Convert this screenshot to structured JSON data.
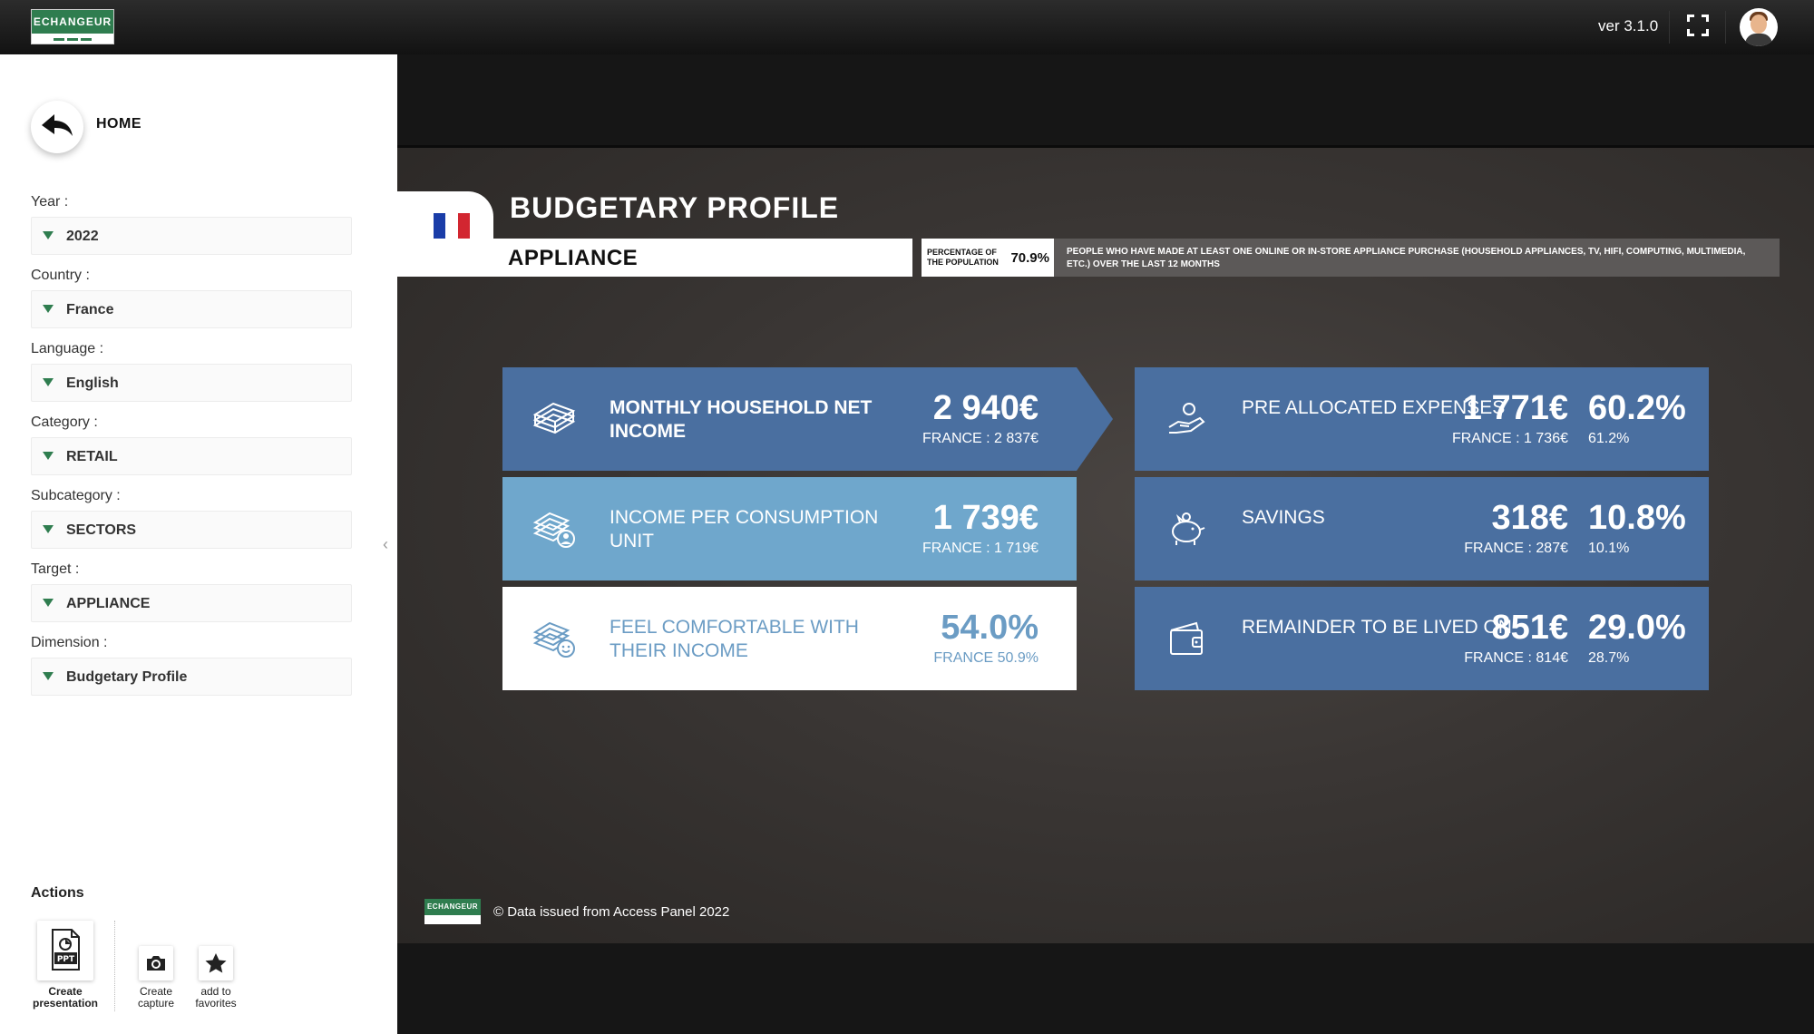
{
  "topbar": {
    "logo_text": "ECHANGEUR",
    "version": "ver 3.1.0"
  },
  "sidebar": {
    "home_label": "HOME",
    "filters": [
      {
        "label": "Year :",
        "value": "2022"
      },
      {
        "label": "Country :",
        "value": "France"
      },
      {
        "label": "Language :",
        "value": "English"
      },
      {
        "label": "Category :",
        "value": "RETAIL"
      },
      {
        "label": "Subcategory :",
        "value": "SECTORS"
      },
      {
        "label": "Target :",
        "value": "APPLIANCE"
      },
      {
        "label": "Dimension :",
        "value": "Budgetary Profile"
      }
    ],
    "actions_title": "Actions",
    "actions": {
      "presentation": "Create presentation",
      "ppt_badge": "PPT",
      "capture": "Create capture",
      "favorites": "add to favorites"
    }
  },
  "report": {
    "flag_colors": [
      "#1a3da8",
      "#ffffff",
      "#d22630"
    ],
    "title": "BUDGETARY PROFILE",
    "subtitle": "APPLIANCE",
    "population_label": "PERCENTAGE OF THE POPULATION",
    "population_value": "70.9%",
    "description": "PEOPLE WHO HAVE MADE AT LEAST ONE ONLINE OR IN-STORE APPLIANCE PURCHASE (HOUSEHOLD APPLIANCES, TV, HIFI, COMPUTING, MULTIMEDIA, ETC.) OVER THE LAST 12 MONTHS",
    "left_cards": [
      {
        "label": "MONTHLY HOUSEHOLD NET INCOME",
        "value": "2 940€",
        "france": "FRANCE : 2 837€"
      },
      {
        "label": "INCOME PER CONSUMPTION UNIT",
        "value": "1 739€",
        "france": "FRANCE : 1 719€"
      },
      {
        "label": "FEEL COMFORTABLE WITH THEIR INCOME",
        "value": "54.0%",
        "france": "FRANCE 50.9%"
      }
    ],
    "right_cards": [
      {
        "label": "PRE ALLOCATED EXPENSES",
        "value": "1 771€",
        "france": "FRANCE : 1 736€",
        "pct": "60.2%",
        "pct_france": "61.2%"
      },
      {
        "label": "SAVINGS",
        "value": "318€",
        "france": "FRANCE : 287€",
        "pct": "10.8%",
        "pct_france": "10.1%"
      },
      {
        "label": "REMAINDER TO BE LIVED ON",
        "value": "851€",
        "france": "FRANCE : 814€",
        "pct": "29.0%",
        "pct_france": "28.7%"
      }
    ],
    "footer": "© Data issued from Access Panel 2022",
    "footer_logo": "ECHANGEUR"
  },
  "colors": {
    "card_dark": "#4a6fa0",
    "card_light": "#6fa7cc",
    "accent_green": "#2f7d4f"
  }
}
